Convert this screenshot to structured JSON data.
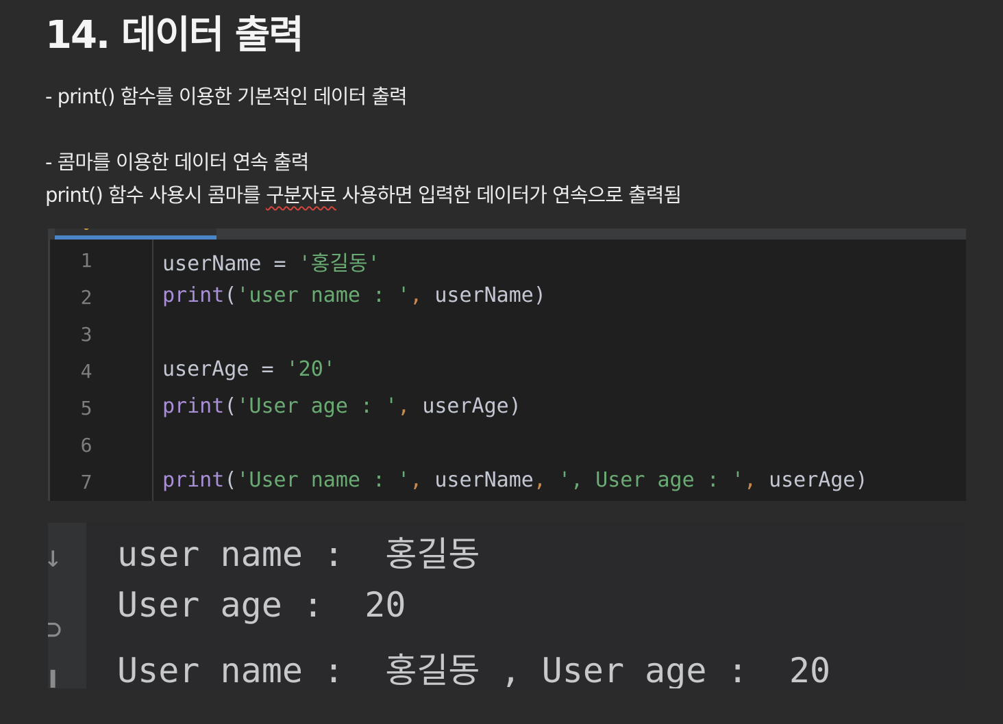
{
  "title": "14. 데이터 출력",
  "paragraphs": {
    "p1": "- print() 함수를 이용한 기본적인 데이터 출력",
    "p2": "- 콤마를 이용한 데이터 연속 출력",
    "p3_before": "print() 함수 사용시 콤마를 ",
    "p3_flagged": "구분자로",
    "p3_after": " 사용하면 입력한 데이터가 연속으로 출력됨"
  },
  "editor": {
    "line_numbers": [
      "1",
      "2",
      "3",
      "4",
      "5",
      "6",
      "7"
    ],
    "line1": {
      "var": "userName",
      "op": " = ",
      "str": "'홍길동'"
    },
    "line2": {
      "fn": "print",
      "open": "(",
      "str": "'user name : '",
      "comma": ", ",
      "arg": "userName",
      "close": ")"
    },
    "line4": {
      "var": "userAge",
      "op": " = ",
      "str": "'20'"
    },
    "line5": {
      "fn": "print",
      "open": "(",
      "str": "'User age : '",
      "comma": ", ",
      "arg": "userAge",
      "close": ")"
    },
    "line7": {
      "fn": "print",
      "open": "(",
      "str1": "'User name : '",
      "comma1": ", ",
      "arg1": "userName",
      "comma2": ", ",
      "str2": "', User age : '",
      "comma3": ", ",
      "arg2": "userAge",
      "close": ")"
    }
  },
  "console": {
    "icons": [
      "down-arrow-icon",
      "wrap-icon",
      "print-icon"
    ],
    "lines": [
      "user name :  홍길동",
      "User age :  20",
      "User name :  홍길동 , User age :  20"
    ]
  },
  "colors": {
    "background": "#2b2b2b",
    "editor_bg": "#1f1f20",
    "keyword": "#a98fd5",
    "string": "#6aab73",
    "identifier": "#c2c7d2",
    "comma": "#c78a50",
    "tab_underline": "#4a86c7",
    "spellcheck": "#d2463c"
  }
}
